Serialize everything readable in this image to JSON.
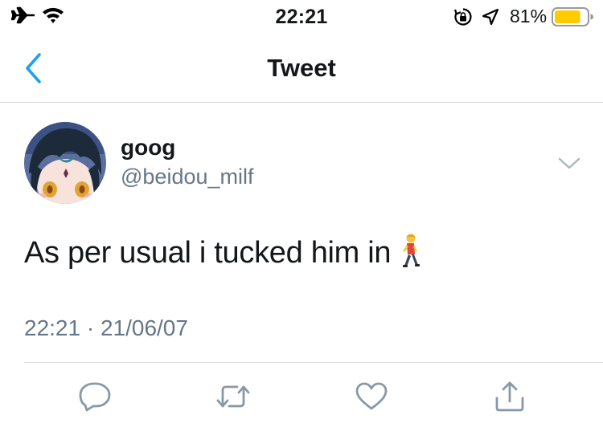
{
  "status_bar": {
    "time": "22:21",
    "battery_percent": "81%",
    "battery_level": 0.81,
    "icons": [
      "airplane-icon",
      "wifi-icon",
      "rotation-lock-icon",
      "location-icon",
      "battery-icon"
    ]
  },
  "nav": {
    "title": "Tweet",
    "back_icon": "chevron-left-icon"
  },
  "tweet": {
    "display_name": "goog",
    "username": "@beidou_milf",
    "text": "As per usual i tucked him in",
    "emoji": "walking-person-emoji",
    "timestamp": "22:21 · 21/06/07"
  },
  "actions": [
    "reply-icon",
    "retweet-icon",
    "like-icon",
    "share-icon"
  ],
  "colors": {
    "accent": "#1da1f2",
    "muted_text": "#657786",
    "icon_gray": "#8899a6",
    "divider": "#d6d8da",
    "battery_fill": "#ffcc00"
  }
}
